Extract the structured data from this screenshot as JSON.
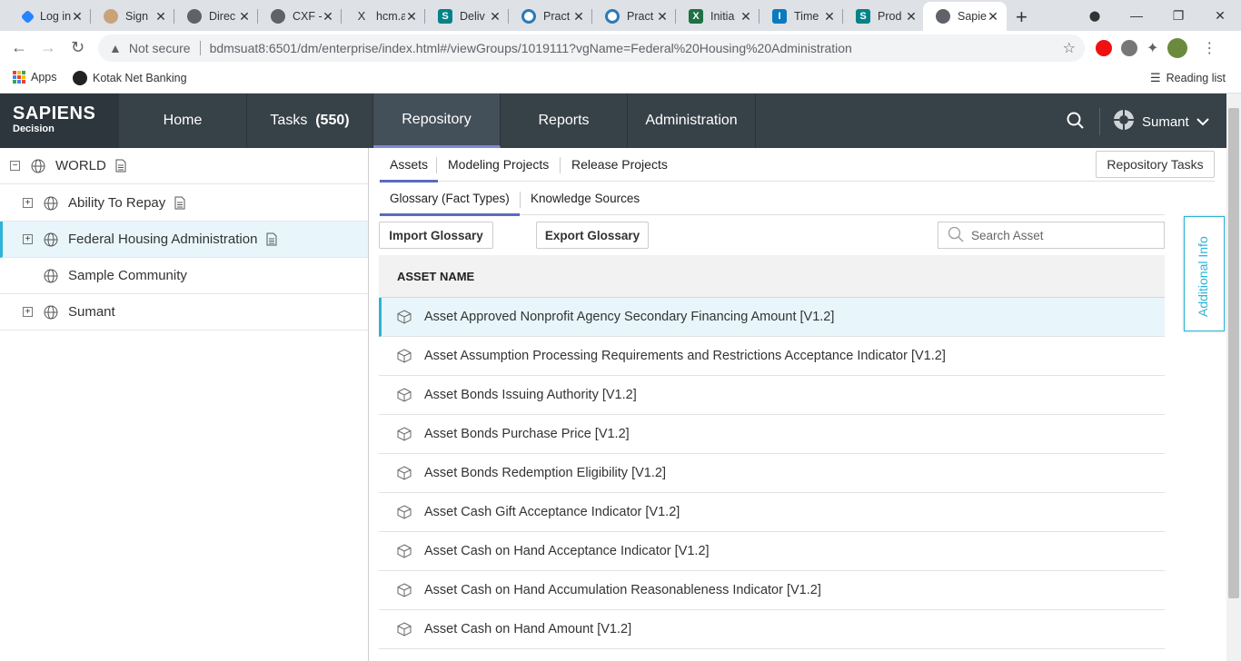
{
  "browser": {
    "tabs": [
      {
        "title": "Log in",
        "icon": "jira-icon"
      },
      {
        "title": "Sign",
        "icon": "avatar-icon"
      },
      {
        "title": "Direc",
        "icon": "globe-icon"
      },
      {
        "title": "CXF -",
        "icon": "globe-icon"
      },
      {
        "title": "hcm.a",
        "icon": "x-icon"
      },
      {
        "title": "Deliv",
        "icon": "sharepoint-icon"
      },
      {
        "title": "Pract",
        "icon": "sync-icon"
      },
      {
        "title": "Pract",
        "icon": "sync-icon"
      },
      {
        "title": "Initia",
        "icon": "excel-icon"
      },
      {
        "title": "Time",
        "icon": "timesheet-icon"
      },
      {
        "title": "Prod",
        "icon": "sharepoint-icon"
      },
      {
        "title": "Sapie",
        "icon": "globe-icon",
        "active": true
      }
    ],
    "address": {
      "security_label": "Not secure",
      "url": "bdmsuat8:6501/dm/enterprise/index.html#/viewGroups/1019111?vgName=Federal%20Housing%20Administration"
    },
    "bookmarks": {
      "apps": "Apps",
      "kotak": "Kotak Net Banking",
      "reading_list": "Reading list"
    }
  },
  "app": {
    "logo": {
      "line1": "SAPIENS",
      "line2": "Decision"
    },
    "nav": {
      "home": "Home",
      "tasks": "Tasks",
      "tasks_count": "(550)",
      "repository": "Repository",
      "reports": "Reports",
      "administration": "Administration"
    },
    "user": "Sumant"
  },
  "tree": {
    "root": "WORLD",
    "items": [
      "Ability To Repay",
      "Federal Housing Administration",
      "Sample Community",
      "Sumant"
    ]
  },
  "main": {
    "tabs": {
      "assets": "Assets",
      "modeling": "Modeling Projects",
      "release": "Release Projects"
    },
    "repo_tasks": "Repository Tasks",
    "subtabs": {
      "glossary": "Glossary (Fact Types)",
      "knowledge": "Knowledge Sources"
    },
    "import_btn": "Import Glossary",
    "export_btn": "Export Glossary",
    "search_placeholder": "Search Asset",
    "column_header": "ASSET NAME",
    "assets": [
      "Asset Approved Nonprofit Agency Secondary Financing Amount [V1.2]",
      "Asset Assumption Processing Requirements and Restrictions Acceptance Indicator [V1.2]",
      "Asset Bonds Issuing Authority [V1.2]",
      "Asset Bonds Purchase Price [V1.2]",
      "Asset Bonds Redemption Eligibility [V1.2]",
      "Asset Cash Gift Acceptance Indicator [V1.2]",
      "Asset Cash on Hand Acceptance Indicator [V1.2]",
      "Asset Cash on Hand Accumulation Reasonableness Indicator [V1.2]",
      "Asset Cash on Hand Amount [V1.2]"
    ],
    "additional_info": "Additional Info"
  }
}
